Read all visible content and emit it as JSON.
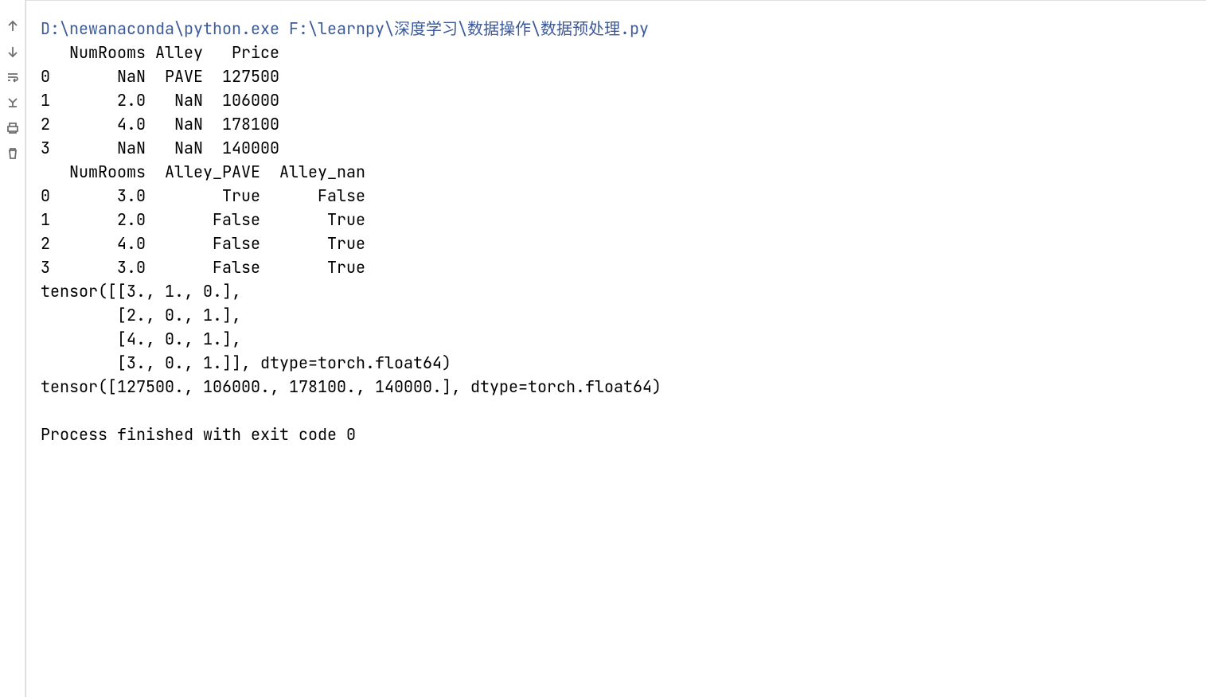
{
  "command": {
    "interpreter": "D:\\newanaconda\\python.exe",
    "script": "F:\\learnpy\\深度学习\\数据操作\\数据预处理.py"
  },
  "output_lines": [
    "   NumRooms Alley   Price",
    "0       NaN  PAVE  127500",
    "1       2.0   NaN  106000",
    "2       4.0   NaN  178100",
    "3       NaN   NaN  140000",
    "   NumRooms  Alley_PAVE  Alley_nan",
    "0       3.0        True      False",
    "1       2.0       False       True",
    "2       4.0       False       True",
    "3       3.0       False       True",
    "tensor([[3., 1., 0.],",
    "        [2., 0., 1.],",
    "        [4., 0., 1.],",
    "        [3., 0., 1.]], dtype=torch.float64)",
    "tensor([127500., 106000., 178100., 140000.], dtype=torch.float64)",
    "",
    "Process finished with exit code 0"
  ],
  "toolbar": {
    "up": "up",
    "down": "down",
    "wrap": "wrap",
    "scroll": "scroll-to-end",
    "print": "print",
    "trash": "trash"
  }
}
